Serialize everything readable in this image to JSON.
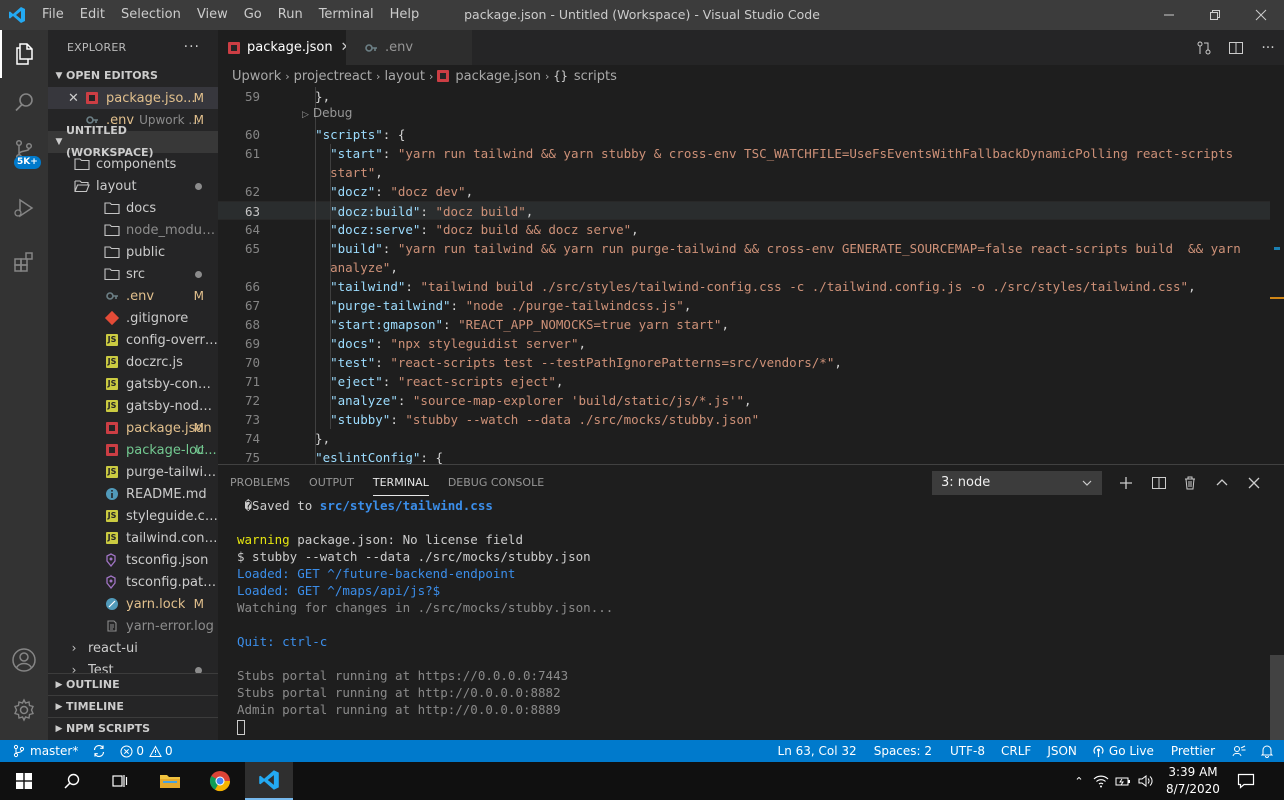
{
  "titlebar": {
    "title": "package.json - Untitled (Workspace) - Visual Studio Code",
    "menu": [
      "File",
      "Edit",
      "Selection",
      "View",
      "Go",
      "Run",
      "Terminal",
      "Help"
    ]
  },
  "activity": {
    "source_control_badge": "5K+"
  },
  "explorer": {
    "title": "EXPLORER",
    "open_editors_label": "OPEN EDITORS",
    "open_editors": [
      {
        "name": "package.jso...",
        "status": "M"
      },
      {
        "name": ".env",
        "desc": "Upwork ...",
        "status": "M"
      }
    ],
    "workspace_label": "UNTITLED (WORKSPACE)",
    "tree": [
      {
        "name": "components",
        "kind": "folder"
      },
      {
        "name": "layout",
        "kind": "folder-open"
      },
      {
        "name": "docs",
        "kind": "folder"
      },
      {
        "name": "node_modules",
        "kind": "folder"
      },
      {
        "name": "public",
        "kind": "folder"
      },
      {
        "name": "src",
        "kind": "folder"
      },
      {
        "name": ".env",
        "kind": "env",
        "status": "M"
      },
      {
        "name": ".gitignore",
        "kind": "git"
      },
      {
        "name": "config-overrides.js",
        "kind": "js"
      },
      {
        "name": "doczrc.js",
        "kind": "js"
      },
      {
        "name": "gatsby-config.js",
        "kind": "js"
      },
      {
        "name": "gatsby-node.js",
        "kind": "js"
      },
      {
        "name": "package.json",
        "kind": "json",
        "status": "M"
      },
      {
        "name": "package-loc...",
        "kind": "json",
        "status": "U"
      },
      {
        "name": "purge-tailwindcss....",
        "kind": "js"
      },
      {
        "name": "README.md",
        "kind": "info"
      },
      {
        "name": "styleguide.config.js",
        "kind": "js"
      },
      {
        "name": "tailwind.config.js",
        "kind": "js"
      },
      {
        "name": "tsconfig.json",
        "kind": "ts"
      },
      {
        "name": "tsconfig.paths.json",
        "kind": "ts"
      },
      {
        "name": "yarn.lock",
        "kind": "yarn",
        "status": "M"
      },
      {
        "name": "yarn-error.log",
        "kind": "log"
      },
      {
        "name": "react-ui",
        "kind": "root"
      },
      {
        "name": "Test",
        "kind": "root"
      }
    ],
    "outline_label": "OUTLINE",
    "timeline_label": "TIMELINE",
    "npm_label": "NPM SCRIPTS"
  },
  "tabs": [
    {
      "label": "package.json",
      "active": true
    },
    {
      "label": ".env",
      "active": false
    }
  ],
  "breadcrumbs": [
    "Upwork",
    "projectreact",
    "layout",
    "package.json",
    "scripts"
  ],
  "editor": {
    "codelens": "Debug",
    "lines": [
      {
        "n": "59",
        "text": "  },",
        "y": 0
      },
      {
        "n": "60",
        "key": "\"scripts\"",
        "rest": ": {",
        "indent": "  ",
        "y": 2
      },
      {
        "n": "61",
        "key": "\"start\"",
        "val": "\"yarn run tailwind && yarn stubby & cross-env TSC_WATCHFILE=UseFsEventsWithFallbackDynamicPolling react-scripts",
        "indent": "    ",
        "y": 3
      },
      {
        "n": "",
        "val": "start\"",
        "tail": ",",
        "indent": "    ",
        "y": 4
      },
      {
        "n": "62",
        "key": "\"docz\"",
        "val": "\"docz dev\"",
        "tail": ",",
        "indent": "    ",
        "y": 5
      },
      {
        "n": "63",
        "key": "\"docz:build\"",
        "val": "\"docz build\"",
        "tail": ",",
        "indent": "    ",
        "y": 6,
        "current": true
      },
      {
        "n": "64",
        "key": "\"docz:serve\"",
        "val": "\"docz build && docz serve\"",
        "tail": ",",
        "indent": "    ",
        "y": 7
      },
      {
        "n": "65",
        "key": "\"build\"",
        "val": "\"yarn run tailwind && yarn run purge-tailwind && cross-env GENERATE_SOURCEMAP=false react-scripts build  && yarn",
        "indent": "    ",
        "y": 8
      },
      {
        "n": "",
        "val": "analyze\"",
        "tail": ",",
        "indent": "    ",
        "y": 9
      },
      {
        "n": "66",
        "key": "\"tailwind\"",
        "val": "\"tailwind build ./src/styles/tailwind-config.css -c ./tailwind.config.js -o ./src/styles/tailwind.css\"",
        "tail": ",",
        "indent": "    ",
        "y": 10
      },
      {
        "n": "67",
        "key": "\"purge-tailwind\"",
        "val": "\"node ./purge-tailwindcss.js\"",
        "tail": ",",
        "indent": "    ",
        "y": 11
      },
      {
        "n": "68",
        "key": "\"start:gmapson\"",
        "val": "\"REACT_APP_NOMOCKS=true yarn start\"",
        "tail": ",",
        "indent": "    ",
        "y": 12
      },
      {
        "n": "69",
        "key": "\"docs\"",
        "val": "\"npx styleguidist server\"",
        "tail": ",",
        "indent": "    ",
        "y": 13
      },
      {
        "n": "70",
        "key": "\"test\"",
        "val": "\"react-scripts test --testPathIgnorePatterns=src/vendors/*\"",
        "tail": ",",
        "indent": "    ",
        "y": 14
      },
      {
        "n": "71",
        "key": "\"eject\"",
        "val": "\"react-scripts eject\"",
        "tail": ",",
        "indent": "    ",
        "y": 15
      },
      {
        "n": "72",
        "key": "\"analyze\"",
        "val": "\"source-map-explorer 'build/static/js/*.js'\"",
        "tail": ",",
        "indent": "    ",
        "y": 16
      },
      {
        "n": "73",
        "key": "\"stubby\"",
        "val": "\"stubby --watch --data ./src/mocks/stubby.json\"",
        "indent": "    ",
        "y": 17
      },
      {
        "n": "74",
        "text": "  },",
        "y": 18
      },
      {
        "n": "75",
        "key": "\"eslintConfig\"",
        "rest": ": {",
        "indent": "  ",
        "y": 19
      }
    ]
  },
  "panel": {
    "tabs": [
      "PROBLEMS",
      "OUTPUT",
      "TERMINAL",
      "DEBUG CONSOLE"
    ],
    "active_tab": "TERMINAL",
    "terminal_select": "3: node",
    "terminal": [
      {
        "pre": " �Saved to ",
        "hl": "src/styles/tailwind.css",
        "cls": ""
      },
      {
        "text": "",
        "cls": ""
      },
      {
        "warn": "warning",
        "text": " package.json: No license field",
        "cls": ""
      },
      {
        "text": "$ stubby --watch --data ./src/mocks/stubby.json",
        "cls": ""
      },
      {
        "text": "Loaded: GET ^/future-backend-endpoint",
        "cls": "blue"
      },
      {
        "text": "Loaded: GET ^/maps/api/js?$",
        "cls": "blue"
      },
      {
        "text": "Watching for changes in ./src/mocks/stubby.json...",
        "cls": "gray"
      },
      {
        "text": "",
        "cls": ""
      },
      {
        "text": "Quit: ctrl-c",
        "cls": "blue"
      },
      {
        "text": "",
        "cls": ""
      },
      {
        "text": "Stubs portal running at https://0.0.0.0:7443",
        "cls": "gray"
      },
      {
        "text": "Stubs portal running at http://0.0.0.0:8882",
        "cls": "gray"
      },
      {
        "text": "Admin portal running at http://0.0.0.0:8889",
        "cls": "gray"
      }
    ]
  },
  "statusbar": {
    "branch": "master*",
    "errors": "0",
    "warnings": "0",
    "position": "Ln 63, Col 32",
    "spaces": "Spaces: 2",
    "encoding": "UTF-8",
    "eol": "CRLF",
    "language": "JSON",
    "golive": "Go Live",
    "prettier": "Prettier"
  },
  "taskbar": {
    "time": "3:39 AM",
    "date": "8/7/2020"
  },
  "colors": {
    "accent": "#007acc",
    "titlebar": "#3c3c3c",
    "editor_bg": "#1e1e1e"
  }
}
